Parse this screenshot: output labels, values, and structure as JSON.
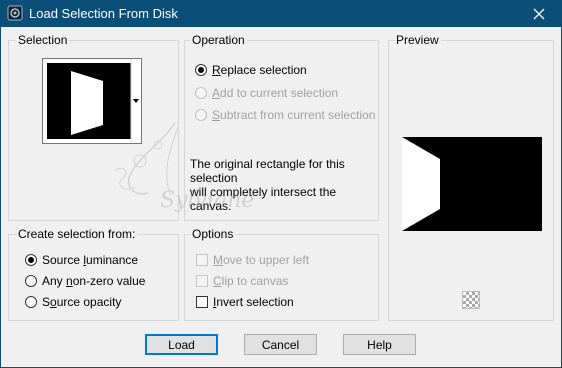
{
  "window": {
    "title": "Load Selection From Disk",
    "close_icon": "close-icon"
  },
  "selection": {
    "group_title": "Selection",
    "dropdown_icon": "chevron-down-icon"
  },
  "operation": {
    "group_title": "Operation",
    "options": [
      {
        "prefix": "",
        "underlined": "R",
        "suffix": "eplace selection",
        "checked": true,
        "enabled": true
      },
      {
        "prefix": "",
        "underlined": "A",
        "suffix": "dd to current selection",
        "checked": false,
        "enabled": false
      },
      {
        "prefix": "",
        "underlined": "S",
        "suffix": "ubtract from current selection",
        "checked": false,
        "enabled": false
      }
    ],
    "note_line1": "The original rectangle for this selection",
    "note_line2": "will completely intersect the canvas."
  },
  "preview": {
    "group_title": "Preview",
    "checker_icon": "transparency-checker-icon"
  },
  "create_from": {
    "group_title": "Create selection from:",
    "options": [
      {
        "prefix": "Source ",
        "underlined": "l",
        "suffix": "uminance",
        "checked": true
      },
      {
        "prefix": "Any ",
        "underlined": "n",
        "suffix": "on-zero value",
        "checked": false
      },
      {
        "prefix": "S",
        "underlined": "o",
        "suffix": "urce opacity",
        "checked": false
      }
    ]
  },
  "options": {
    "group_title": "Options",
    "items": [
      {
        "prefix": "",
        "underlined": "M",
        "suffix": "ove to upper left",
        "checked": false,
        "enabled": false
      },
      {
        "prefix": "",
        "underlined": "C",
        "suffix": "lip to canvas",
        "checked": false,
        "enabled": false
      },
      {
        "prefix": "",
        "underlined": "I",
        "suffix": "nvert selection",
        "checked": false,
        "enabled": true
      }
    ]
  },
  "buttons": {
    "load": "Load",
    "cancel": "Cancel",
    "help": "Help"
  },
  "watermark": {
    "text": "Sylviane"
  },
  "colors": {
    "titlebar": "#0b4f78",
    "accent": "#0078d7"
  }
}
